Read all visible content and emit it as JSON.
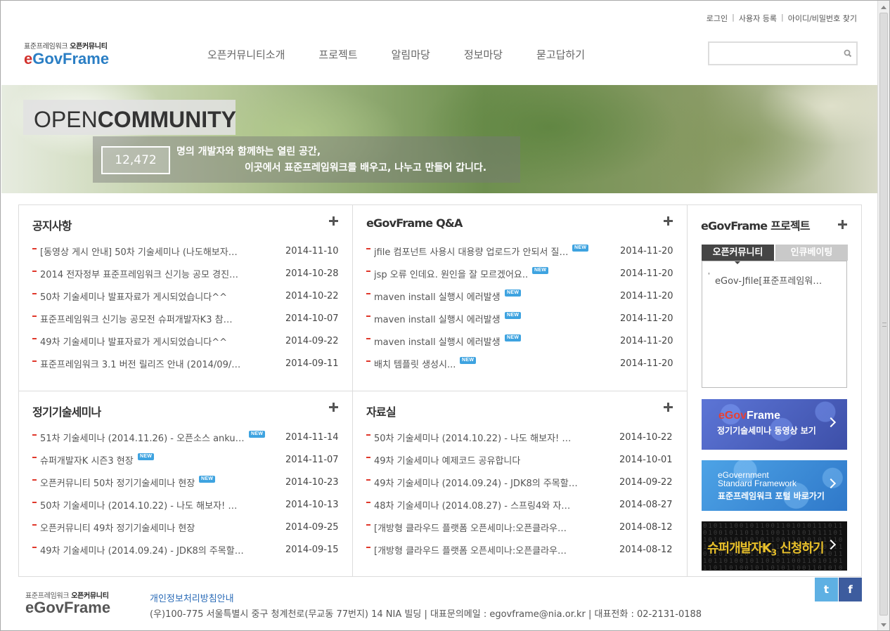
{
  "util": {
    "login": "로그인",
    "register": "사용자 등록",
    "find": "아이디/비밀번호 찾기",
    "sep": "|"
  },
  "logo": {
    "sub_prefix": "표준프레임워크",
    "sub_bold": "오픈커뮤니티",
    "main_e": "e",
    "main_rest": "GovFrame"
  },
  "nav": [
    "오픈커뮤니티소개",
    "프로젝트",
    "알림마당",
    "정보마당",
    "묻고답하기"
  ],
  "search": {
    "placeholder": "",
    "value": "",
    "icon": "search-icon"
  },
  "banner": {
    "open": "OPEN",
    "community": "COMMUNITY",
    "count": "12,472",
    "line1": "명의 개발자와 함께하는 열린 공간,",
    "line2": "이곳에서 표준프레임워크를 배우고, 나누고 만들어 갑니다."
  },
  "new_badge": "NEW",
  "notice": {
    "title": "공지사항",
    "items": [
      {
        "text": "[동영상 게시 안내] 50차 기술세미나 (나도해보자…",
        "date": "2014-11-10",
        "new": false
      },
      {
        "text": "2014 전자정부 표준프레임워크 신기능 공모 경진…",
        "date": "2014-10-28",
        "new": false
      },
      {
        "text": "50차 기술세미나 발표자료가 게시되었습니다^^",
        "date": "2014-10-22",
        "new": false
      },
      {
        "text": "표준프레임워크 신기능 공모전 슈퍼개발자K3 참…",
        "date": "2014-10-07",
        "new": false
      },
      {
        "text": "49차 기술세미나 발표자료가 게시되었습니다^^",
        "date": "2014-09-22",
        "new": false
      },
      {
        "text": "표준프레임워크 3.1 버전 릴리즈 안내 (2014/09/…",
        "date": "2014-09-11",
        "new": false
      }
    ]
  },
  "qna": {
    "title": "eGovFrame Q&A",
    "items": [
      {
        "text": "jfile 컴포넌트 사용시 대용량 업로드가 안되서 질…",
        "date": "2014-11-20",
        "new": true
      },
      {
        "text": "jsp 오류 인데요. 원인을 잘 모르겠어요..",
        "date": "2014-11-20",
        "new": true
      },
      {
        "text": "maven install 실행시 에러발생",
        "date": "2014-11-20",
        "new": true
      },
      {
        "text": "maven install 실행시 에러발생",
        "date": "2014-11-20",
        "new": true
      },
      {
        "text": "maven install 실행시 에러발생",
        "date": "2014-11-20",
        "new": true
      },
      {
        "text": "배치 템플릿 생성시...",
        "date": "2014-11-20",
        "new": true
      }
    ]
  },
  "seminar": {
    "title": "정기기술세미나",
    "items": [
      {
        "text": "51차 기술세미나 (2014.11.26) - 오픈소스 anku…",
        "date": "2014-11-14",
        "new": true
      },
      {
        "text": "슈퍼개발자K 시즌3 현장",
        "date": "2014-11-07",
        "new": true
      },
      {
        "text": "오픈커뮤니티 50차 정기기술세미나 현장",
        "date": "2014-10-23",
        "new": true
      },
      {
        "text": "50차 기술세미나 (2014.10.22) - 나도 해보자! …",
        "date": "2014-10-13",
        "new": false
      },
      {
        "text": "오픈커뮤니티 49차 정기기술세미나 현장",
        "date": "2014-09-25",
        "new": false
      },
      {
        "text": "49차 기술세미나 (2014.09.24) - JDK8의 주목할…",
        "date": "2014-09-15",
        "new": false
      }
    ]
  },
  "archive": {
    "title": "자료실",
    "items": [
      {
        "text": "50차 기술세미나 (2014.10.22) - 나도 해보자! …",
        "date": "2014-10-22",
        "new": false
      },
      {
        "text": "49차 기술세미나 예제코드 공유합니다",
        "date": "2014-10-01",
        "new": false
      },
      {
        "text": "49차 기술세미나 (2014.09.24) - JDK8의 주목할…",
        "date": "2014-09-22",
        "new": false
      },
      {
        "text": "48차 기술세미나 (2014.08.27) - 스프링4와 자…",
        "date": "2014-08-27",
        "new": false
      },
      {
        "text": "[개방형 클라우드 플랫폼 오픈세미나:오픈클라우…",
        "date": "2014-08-12",
        "new": false
      },
      {
        "text": "[개방형 클라우드 플랫폼 오픈세미나:오픈클라우…",
        "date": "2014-08-12",
        "new": false
      }
    ]
  },
  "project": {
    "title": "eGovFrame 프로젝트",
    "tabs": [
      "오픈커뮤니티",
      "인큐베이팅"
    ],
    "active_tab": 0,
    "items": [
      "eGov-Jfile[표준프레임워…"
    ]
  },
  "banners": {
    "b1_red": "eGov",
    "b1_white": "Frame",
    "b1_sub": "정기기술세미나 동영상 보기",
    "b2_l1": "eGovernment",
    "b2_l2": "Standard Framework",
    "b2_sub": "표준프레임워크 포털 바로가기",
    "b3_main": "슈퍼개발자K",
    "b3_sub": "3",
    "b3_tail": " 신청하기",
    "b3_bits": "0101110010110011010101110110100101101011001101010111011010010110101100110101011101101001011010110011010101110110100101101011001101010111011010010110101100110101011101101001011010110011010101110110100101101011001101010111011010010110"
  },
  "footer": {
    "policy": "개인정보처리방침안내",
    "address": "(우)100-775 서울특별시 중구 청계천로(무교동 77번지) 14 NIA 빌딩 | 대표문의메일 : egovframe@nia.or.kr | 대표전화 : 02-2131-0188",
    "twitter": "twitter-icon",
    "facebook": "facebook-icon",
    "tw_glyph": "t",
    "fb_glyph": "f"
  },
  "colors": {
    "accent_red": "#e0382b",
    "brand_blue": "#2a7ec4",
    "new_badge": "#3ea3e0"
  }
}
